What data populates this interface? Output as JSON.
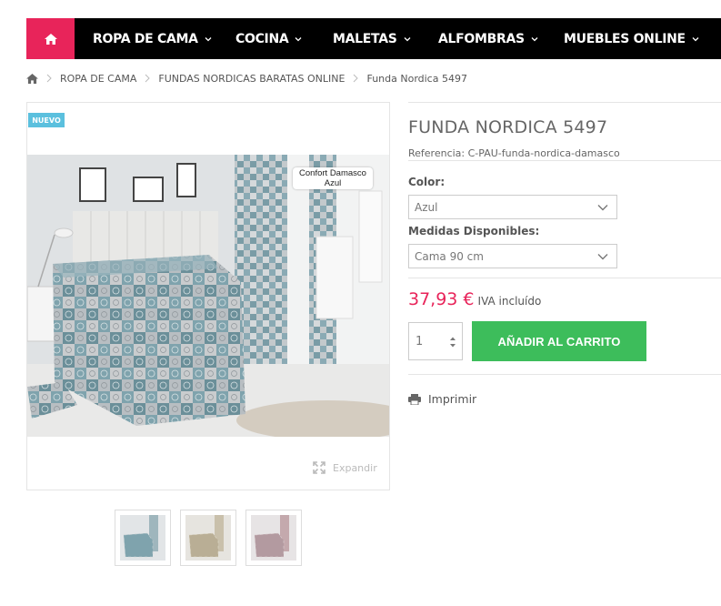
{
  "nav": {
    "home_icon": "home-icon",
    "items": [
      {
        "label": "ROPA DE CAMA"
      },
      {
        "label": "COCINA"
      },
      {
        "label": "MALETAS"
      },
      {
        "label": "ALFOMBRAS"
      },
      {
        "label": "MUEBLES ONLINE"
      }
    ],
    "accent_color": "#e8245a"
  },
  "breadcrumb": {
    "items": [
      "ROPA DE CAMA",
      "FUNDAS NORDICAS BARATAS ONLINE",
      "Funda Nordica 5497"
    ]
  },
  "gallery": {
    "badge": "NUEVO",
    "caption": "Confort Damasco Azul",
    "expand_label": "Expandir",
    "thumbnails": [
      "thumbnail-blue",
      "thumbnail-beige",
      "thumbnail-mauve"
    ]
  },
  "product": {
    "title": "FUNDA NORDICA 5497",
    "reference": "Referencia: C-PAU-funda-nordica-damasco",
    "color_label": "Color:",
    "color_value": "Azul",
    "size_label": "Medidas Disponibles:",
    "size_value": "Cama 90 cm",
    "price": "37,93 €",
    "tax_note": "IVA incluído",
    "quantity": "1",
    "add_to_cart": "AÑADIR AL CARRITO",
    "print_label": "Imprimir",
    "price_color": "#e8245a",
    "button_color": "#3dbd5b"
  }
}
